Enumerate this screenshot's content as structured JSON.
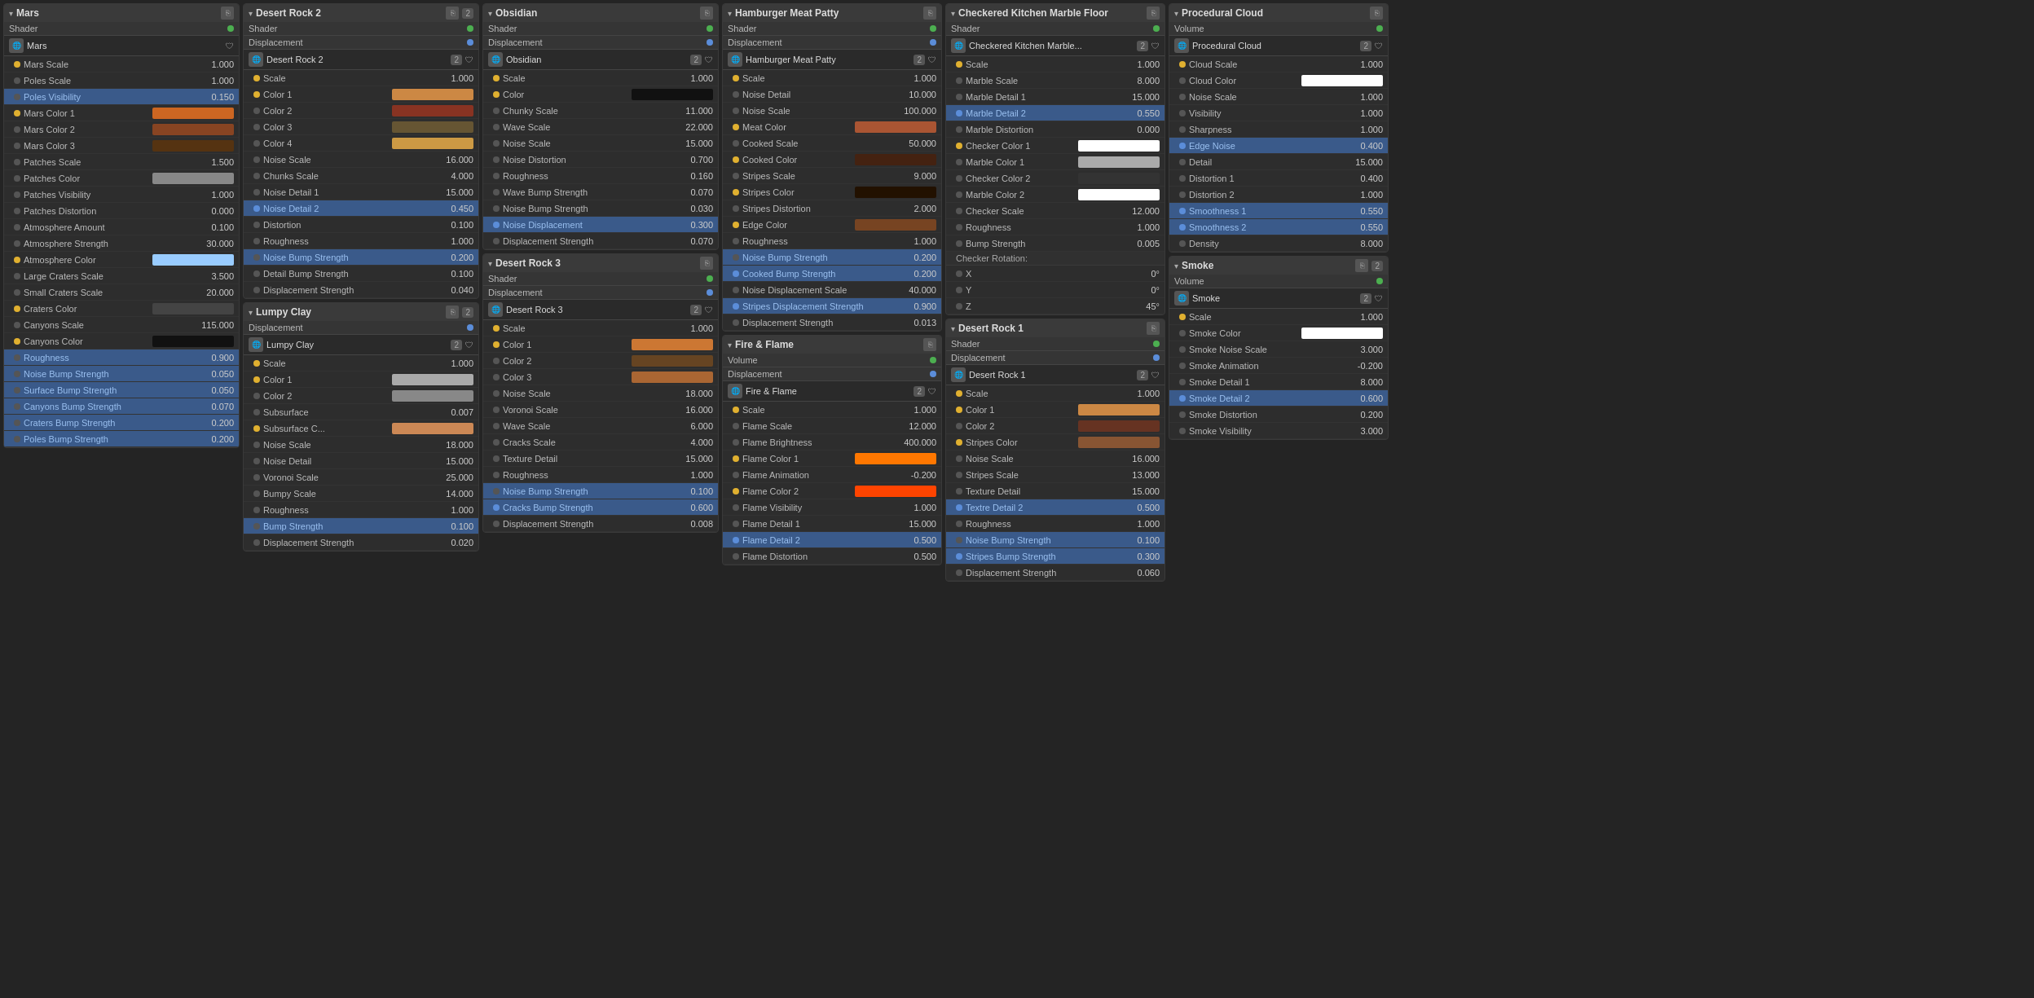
{
  "panels": {
    "mars": {
      "title": "Mars",
      "shader_label": "Shader",
      "node_name": "Mars",
      "props": [
        {
          "label": "Mars Scale",
          "value": "1.000",
          "dot": "yellow"
        },
        {
          "label": "Poles Scale",
          "value": "1.000",
          "dot": "none"
        },
        {
          "label": "Poles Visibility",
          "value": "0.150",
          "dot": "none",
          "highlight": true
        },
        {
          "label": "Mars Color 1",
          "value": "",
          "dot": "yellow",
          "color": "#cc6622"
        },
        {
          "label": "Mars Color 2",
          "value": "",
          "dot": "none",
          "color": "#884422"
        },
        {
          "label": "Mars Color 3",
          "value": "",
          "dot": "none",
          "color": "#553311"
        },
        {
          "label": "Patches Scale",
          "value": "1.500",
          "dot": "none"
        },
        {
          "label": "Patches Color",
          "value": "",
          "dot": "none",
          "color": "#888888"
        },
        {
          "label": "Patches Visibility",
          "value": "1.000",
          "dot": "none"
        },
        {
          "label": "Patches Distortion",
          "value": "0.000",
          "dot": "none"
        },
        {
          "label": "Atmosphere Amount",
          "value": "0.100",
          "dot": "none"
        },
        {
          "label": "Atmosphere Strength",
          "value": "30.000",
          "dot": "none"
        },
        {
          "label": "Atmosphere Color",
          "value": "",
          "dot": "yellow",
          "color": "#99ccff"
        },
        {
          "label": "Large Craters Scale",
          "value": "3.500",
          "dot": "none"
        },
        {
          "label": "Small Craters Scale",
          "value": "20.000",
          "dot": "none"
        },
        {
          "label": "Craters Color",
          "value": "",
          "dot": "yellow",
          "color": "#444444"
        },
        {
          "label": "Canyons Scale",
          "value": "115.000",
          "dot": "none"
        },
        {
          "label": "Canyons Color",
          "value": "",
          "dot": "yellow",
          "color": "#111111"
        },
        {
          "label": "Roughness",
          "value": "0.900",
          "dot": "none",
          "highlight": true
        },
        {
          "label": "Noise Bump Strength",
          "value": "0.050",
          "dot": "none",
          "highlight": true
        },
        {
          "label": "Surface Bump Strength",
          "value": "0.050",
          "dot": "none",
          "highlight": true
        },
        {
          "label": "Canyons Bump Strength",
          "value": "0.070",
          "dot": "none",
          "highlight": true
        },
        {
          "label": "Craters Bump Strength",
          "value": "0.200",
          "dot": "none",
          "highlight": true
        },
        {
          "label": "Poles Bump Strength",
          "value": "0.200",
          "dot": "none",
          "highlight": true
        }
      ]
    },
    "desert_rock_2": {
      "title": "Desert Rock 2",
      "shader_label": "Shader",
      "displacement_label": "Displacement",
      "node_name": "Desert Rock 2",
      "props": [
        {
          "label": "Scale",
          "value": "1.000",
          "dot": "yellow"
        },
        {
          "label": "Color 1",
          "value": "",
          "dot": "yellow",
          "color": "#cc8844"
        },
        {
          "label": "Color 2",
          "value": "",
          "dot": "none",
          "color": "#883322"
        },
        {
          "label": "Color 3",
          "value": "",
          "dot": "none",
          "color": "#665533"
        },
        {
          "label": "Color 4",
          "value": "",
          "dot": "none",
          "color": "#cc9944"
        },
        {
          "label": "Noise Scale",
          "value": "16.000",
          "dot": "none"
        },
        {
          "label": "Chunks Scale",
          "value": "4.000",
          "dot": "none"
        },
        {
          "label": "Noise Detail 1",
          "value": "15.000",
          "dot": "none"
        },
        {
          "label": "Noise Detail 2",
          "value": "0.450",
          "dot": "blue",
          "highlight": true
        },
        {
          "label": "Distortion",
          "value": "0.100",
          "dot": "none"
        },
        {
          "label": "Roughness",
          "value": "1.000",
          "dot": "none"
        },
        {
          "label": "Noise Bump Strength",
          "value": "0.200",
          "dot": "none",
          "highlight": true
        },
        {
          "label": "Detail Bump Strength",
          "value": "0.100",
          "dot": "none"
        },
        {
          "label": "Displacement Strength",
          "value": "0.040",
          "dot": "none"
        }
      ]
    },
    "lumpy_clay": {
      "title": "Lumpy Clay",
      "displacement_label": "Displacement",
      "node_name": "Lumpy Clay",
      "props": [
        {
          "label": "Scale",
          "value": "1.000",
          "dot": "yellow"
        },
        {
          "label": "Color 1",
          "value": "",
          "dot": "yellow",
          "color": "#aaaaaa"
        },
        {
          "label": "Color 2",
          "value": "",
          "dot": "none",
          "color": "#888888"
        },
        {
          "label": "Subsurface",
          "value": "0.007",
          "dot": "none"
        },
        {
          "label": "Subsurface C...",
          "value": "",
          "dot": "yellow",
          "color": "#cc8855"
        },
        {
          "label": "Noise Scale",
          "value": "18.000",
          "dot": "none"
        },
        {
          "label": "Noise Detail",
          "value": "15.000",
          "dot": "none"
        },
        {
          "label": "Voronoi Scale",
          "value": "25.000",
          "dot": "none"
        },
        {
          "label": "Bumpy Scale",
          "value": "14.000",
          "dot": "none"
        },
        {
          "label": "Roughness",
          "value": "1.000",
          "dot": "none"
        },
        {
          "label": "Bump Strength",
          "value": "0.100",
          "dot": "none",
          "highlight": true
        },
        {
          "label": "Displacement Strength",
          "value": "0.020",
          "dot": "none"
        }
      ]
    },
    "obsidian": {
      "title": "Obsidian",
      "shader_label": "Shader",
      "displacement_label": "Displacement",
      "node_name": "Obsidian",
      "props": [
        {
          "label": "Scale",
          "value": "1.000",
          "dot": "yellow"
        },
        {
          "label": "Color",
          "value": "",
          "dot": "yellow",
          "color": "#111111"
        },
        {
          "label": "Chunky Scale",
          "value": "11.000",
          "dot": "none"
        },
        {
          "label": "Wave Scale",
          "value": "22.000",
          "dot": "none"
        },
        {
          "label": "Noise Scale",
          "value": "15.000",
          "dot": "none"
        },
        {
          "label": "Noise Distortion",
          "value": "0.700",
          "dot": "none"
        },
        {
          "label": "Roughness",
          "value": "0.160",
          "dot": "none"
        },
        {
          "label": "Wave Bump Strength",
          "value": "0.070",
          "dot": "none"
        },
        {
          "label": "Noise Bump Strength",
          "value": "0.030",
          "dot": "none"
        },
        {
          "label": "Noise Displacement",
          "value": "0.300",
          "dot": "blue",
          "highlight": true
        },
        {
          "label": "Displacement Strength",
          "value": "0.070",
          "dot": "none"
        }
      ]
    },
    "desert_rock_3": {
      "title": "Desert Rock 3",
      "shader_label": "Shader",
      "displacement_label": "Displacement",
      "node_name": "Desert Rock 3",
      "props": [
        {
          "label": "Scale",
          "value": "1.000",
          "dot": "yellow"
        },
        {
          "label": "Color 1",
          "value": "",
          "dot": "yellow",
          "color": "#cc7733"
        },
        {
          "label": "Color 2",
          "value": "",
          "dot": "none",
          "color": "#664422"
        },
        {
          "label": "Color 3",
          "value": "",
          "dot": "none",
          "color": "#aa6633"
        },
        {
          "label": "Noise Scale",
          "value": "18.000",
          "dot": "none"
        },
        {
          "label": "Voronoi Scale",
          "value": "16.000",
          "dot": "none"
        },
        {
          "label": "Wave Scale",
          "value": "6.000",
          "dot": "none"
        },
        {
          "label": "Cracks Scale",
          "value": "4.000",
          "dot": "none"
        },
        {
          "label": "Texture Detail",
          "value": "15.000",
          "dot": "none"
        },
        {
          "label": "Roughness",
          "value": "1.000",
          "dot": "none"
        },
        {
          "label": "Noise Bump Strength",
          "value": "0.100",
          "dot": "none",
          "highlight": true
        },
        {
          "label": "Cracks Bump Strength",
          "value": "0.600",
          "dot": "blue",
          "highlight": true
        },
        {
          "label": "Displacement Strength",
          "value": "0.008",
          "dot": "none"
        }
      ]
    },
    "hamburger": {
      "title": "Hamburger Meat Patty",
      "shader_label": "Shader",
      "displacement_label": "Displacement",
      "node_name": "Hamburger Meat Patty",
      "props": [
        {
          "label": "Scale",
          "value": "1.000",
          "dot": "yellow"
        },
        {
          "label": "Noise Detail",
          "value": "10.000",
          "dot": "none"
        },
        {
          "label": "Noise Scale",
          "value": "100.000",
          "dot": "none"
        },
        {
          "label": "Meat Color",
          "value": "",
          "dot": "yellow",
          "color": "#aa5533"
        },
        {
          "label": "Cooked Scale",
          "value": "50.000",
          "dot": "none"
        },
        {
          "label": "Cooked Color",
          "value": "",
          "dot": "yellow",
          "color": "#442211"
        },
        {
          "label": "Stripes Scale",
          "value": "9.000",
          "dot": "none"
        },
        {
          "label": "Stripes Color",
          "value": "",
          "dot": "yellow",
          "color": "#221100"
        },
        {
          "label": "Stripes Distortion",
          "value": "2.000",
          "dot": "none"
        },
        {
          "label": "Edge Color",
          "value": "",
          "dot": "yellow",
          "color": "#774422"
        },
        {
          "label": "Roughness",
          "value": "1.000",
          "dot": "none"
        },
        {
          "label": "Noise Bump Strength",
          "value": "0.200",
          "dot": "none",
          "highlight": true
        },
        {
          "label": "Cooked Bump Strength",
          "value": "0.200",
          "dot": "blue",
          "highlight": true
        },
        {
          "label": "Noise Displacement Scale",
          "value": "40.000",
          "dot": "none"
        },
        {
          "label": "Stripes Displacement Strength",
          "value": "0.900",
          "dot": "blue",
          "highlight": true
        },
        {
          "label": "Displacement Strength",
          "value": "0.013",
          "dot": "none"
        }
      ]
    },
    "fire_flame": {
      "title": "Fire & Flame",
      "volume_label": "Volume",
      "displacement_label": "Displacement",
      "node_name": "Fire & Flame",
      "props": [
        {
          "label": "Scale",
          "value": "1.000",
          "dot": "yellow"
        },
        {
          "label": "Flame Scale",
          "value": "12.000",
          "dot": "none"
        },
        {
          "label": "Flame Brightness",
          "value": "400.000",
          "dot": "none"
        },
        {
          "label": "Flame Color 1",
          "value": "",
          "dot": "yellow",
          "color": "#ff7700"
        },
        {
          "label": "Flame Animation",
          "value": "-0.200",
          "dot": "none"
        },
        {
          "label": "Flame Color 2",
          "value": "",
          "dot": "yellow",
          "color": "#ff4400"
        },
        {
          "label": "Flame Visibility",
          "value": "1.000",
          "dot": "none"
        },
        {
          "label": "Flame Detail 1",
          "value": "15.000",
          "dot": "none"
        },
        {
          "label": "Flame Detail 2",
          "value": "0.500",
          "dot": "blue",
          "highlight": true
        },
        {
          "label": "Flame Distortion",
          "value": "0.500",
          "dot": "none"
        }
      ]
    },
    "checkered_marble": {
      "title": "Checkered Kitchen Marble Floor",
      "shader_label": "Shader",
      "node_name": "Checkered Kitchen Marble...",
      "props": [
        {
          "label": "Scale",
          "value": "1.000",
          "dot": "yellow"
        },
        {
          "label": "Marble Scale",
          "value": "8.000",
          "dot": "none"
        },
        {
          "label": "Marble Detail 1",
          "value": "15.000",
          "dot": "none"
        },
        {
          "label": "Marble Detail 2",
          "value": "0.550",
          "dot": "blue",
          "highlight": true
        },
        {
          "label": "Marble Distortion",
          "value": "0.000",
          "dot": "none"
        },
        {
          "label": "Checker Color 1",
          "value": "",
          "dot": "yellow",
          "color": "#ffffff"
        },
        {
          "label": "Marble Color 1",
          "value": "",
          "dot": "none",
          "color": "#aaaaaa"
        },
        {
          "label": "Checker Color 2",
          "value": "",
          "dot": "none",
          "color": "#333333"
        },
        {
          "label": "Marble Color 2",
          "value": "",
          "dot": "none",
          "color": "#ffffff"
        },
        {
          "label": "Checker Scale",
          "value": "12.000",
          "dot": "none"
        },
        {
          "label": "Roughness",
          "value": "1.000",
          "dot": "none"
        },
        {
          "label": "Bump Strength",
          "value": "0.005",
          "dot": "none"
        },
        {
          "label": "Checker Rotation:",
          "value": "",
          "dot": "none"
        },
        {
          "label": "X",
          "value": "0°",
          "dot": "none"
        },
        {
          "label": "Y",
          "value": "0°",
          "dot": "none"
        },
        {
          "label": "Z",
          "value": "45°",
          "dot": "none"
        }
      ]
    },
    "desert_rock_1": {
      "title": "Desert Rock 1",
      "shader_label": "Shader",
      "displacement_label": "Displacement",
      "node_name": "Desert Rock 1",
      "props": [
        {
          "label": "Scale",
          "value": "1.000",
          "dot": "yellow"
        },
        {
          "label": "Color 1",
          "value": "",
          "dot": "yellow",
          "color": "#cc8844"
        },
        {
          "label": "Color 2",
          "value": "",
          "dot": "none",
          "color": "#663322"
        },
        {
          "label": "Stripes Color",
          "value": "",
          "dot": "yellow",
          "color": "#885533"
        },
        {
          "label": "Noise Scale",
          "value": "16.000",
          "dot": "none"
        },
        {
          "label": "Stripes Scale",
          "value": "13.000",
          "dot": "none"
        },
        {
          "label": "Texture Detail",
          "value": "15.000",
          "dot": "none"
        },
        {
          "label": "Textre Detail 2",
          "value": "0.500",
          "dot": "blue",
          "highlight": true
        },
        {
          "label": "Roughness",
          "value": "1.000",
          "dot": "none"
        },
        {
          "label": "Noise Bump Strength",
          "value": "0.100",
          "dot": "none",
          "highlight": true
        },
        {
          "label": "Stripes Bump Strength",
          "value": "0.300",
          "dot": "blue",
          "highlight": true
        },
        {
          "label": "Displacement Strength",
          "value": "0.060",
          "dot": "none"
        }
      ]
    },
    "procedural_cloud": {
      "title": "Procedural Cloud",
      "volume_label": "Volume",
      "node_name": "Procedural Cloud",
      "props": [
        {
          "label": "Cloud Scale",
          "value": "1.000",
          "dot": "yellow"
        },
        {
          "label": "Cloud Color",
          "value": "",
          "dot": "none",
          "color": "#ffffff"
        },
        {
          "label": "Noise Scale",
          "value": "1.000",
          "dot": "none"
        },
        {
          "label": "Visibility",
          "value": "1.000",
          "dot": "none"
        },
        {
          "label": "Sharpness",
          "value": "1.000",
          "dot": "none"
        },
        {
          "label": "Edge Noise",
          "value": "0.400",
          "dot": "blue",
          "highlight": true
        },
        {
          "label": "Detail",
          "value": "15.000",
          "dot": "none"
        },
        {
          "label": "Distortion 1",
          "value": "0.400",
          "dot": "none"
        },
        {
          "label": "Distortion 2",
          "value": "1.000",
          "dot": "none"
        },
        {
          "label": "Smoothness 1",
          "value": "0.550",
          "dot": "blue",
          "highlight": true
        },
        {
          "label": "Smoothness 2",
          "value": "0.550",
          "dot": "blue",
          "highlight": true
        },
        {
          "label": "Density",
          "value": "8.000",
          "dot": "none"
        }
      ]
    },
    "smoke": {
      "title": "Smoke",
      "volume_label": "Volume",
      "node_name": "Smoke",
      "props": [
        {
          "label": "Scale",
          "value": "1.000",
          "dot": "yellow"
        },
        {
          "label": "Smoke Color",
          "value": "",
          "dot": "none",
          "color": "#ffffff"
        },
        {
          "label": "Smoke Noise Scale",
          "value": "3.000",
          "dot": "none"
        },
        {
          "label": "Smoke Animation",
          "value": "-0.200",
          "dot": "none"
        },
        {
          "label": "Smoke Detail 1",
          "value": "8.000",
          "dot": "none"
        },
        {
          "label": "Smoke Detail 2",
          "value": "0.600",
          "dot": "blue",
          "highlight": true
        },
        {
          "label": "Smoke Distortion",
          "value": "0.200",
          "dot": "none"
        },
        {
          "label": "Smoke Visibility",
          "value": "3.000",
          "dot": "none"
        }
      ]
    }
  },
  "ui": {
    "collapse_icon": "▾",
    "expand_icon": "▸",
    "badge": "2",
    "shield": "🛡"
  }
}
